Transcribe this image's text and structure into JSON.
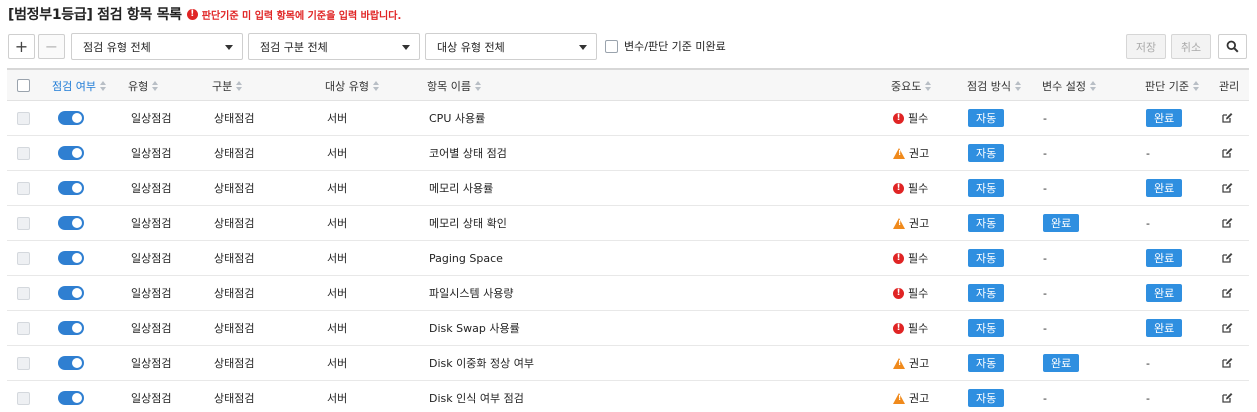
{
  "header": {
    "title": "[범정부1등급] 점검 항목 목록",
    "notice": "판단기준 미 입력 항목에 기준을 입력 바랍니다.",
    "notice_icon": "exclamation-circle-icon"
  },
  "toolbar": {
    "add_label": "+",
    "remove_label": "−",
    "filter_type": "점검 유형 전체",
    "filter_category": "점검 구분 전체",
    "filter_target": "대상 유형 전체",
    "incomplete_label": "변수/판단 기준 미완료",
    "save_label": "저장",
    "cancel_label": "취소"
  },
  "table": {
    "columns": {
      "enabled": "점검 여부",
      "type": "유형",
      "category": "구분",
      "target": "대상 유형",
      "name": "항목 이름",
      "importance": "중요도",
      "method": "점검 방식",
      "variable": "변수 설정",
      "criteria": "판단 기준",
      "manage": "관리"
    },
    "rows": [
      {
        "type": "일상점검",
        "category": "상태점검",
        "target": "서버",
        "name": "CPU 사용률",
        "importance": "필수",
        "method": "자동",
        "variable": "-",
        "criteria": "완료"
      },
      {
        "type": "일상점검",
        "category": "상태점검",
        "target": "서버",
        "name": "코어별 상태 점검",
        "importance": "권고",
        "method": "자동",
        "variable": "-",
        "criteria": "-"
      },
      {
        "type": "일상점검",
        "category": "상태점검",
        "target": "서버",
        "name": "메모리 사용률",
        "importance": "필수",
        "method": "자동",
        "variable": "-",
        "criteria": "완료"
      },
      {
        "type": "일상점검",
        "category": "상태점검",
        "target": "서버",
        "name": "메모리 상태 확인",
        "importance": "권고",
        "method": "자동",
        "variable": "완료",
        "criteria": "-"
      },
      {
        "type": "일상점검",
        "category": "상태점검",
        "target": "서버",
        "name": "Paging Space",
        "importance": "필수",
        "method": "자동",
        "variable": "-",
        "criteria": "완료"
      },
      {
        "type": "일상점검",
        "category": "상태점검",
        "target": "서버",
        "name": "파일시스템 사용량",
        "importance": "필수",
        "method": "자동",
        "variable": "-",
        "criteria": "완료"
      },
      {
        "type": "일상점검",
        "category": "상태점검",
        "target": "서버",
        "name": "Disk Swap 사용률",
        "importance": "필수",
        "method": "자동",
        "variable": "-",
        "criteria": "완료"
      },
      {
        "type": "일상점검",
        "category": "상태점검",
        "target": "서버",
        "name": "Disk 이중화 정상 여부",
        "importance": "권고",
        "method": "자동",
        "variable": "완료",
        "criteria": "-"
      },
      {
        "type": "일상점검",
        "category": "상태점검",
        "target": "서버",
        "name": "Disk 인식 여부 점검",
        "importance": "권고",
        "method": "자동",
        "variable": "-",
        "criteria": "-"
      }
    ]
  },
  "colors": {
    "accent": "#2f8fe0",
    "toggle_on": "#2f7fd1",
    "required": "#e02424",
    "recommended": "#f08a1c",
    "header_link": "#1e7bd6"
  }
}
